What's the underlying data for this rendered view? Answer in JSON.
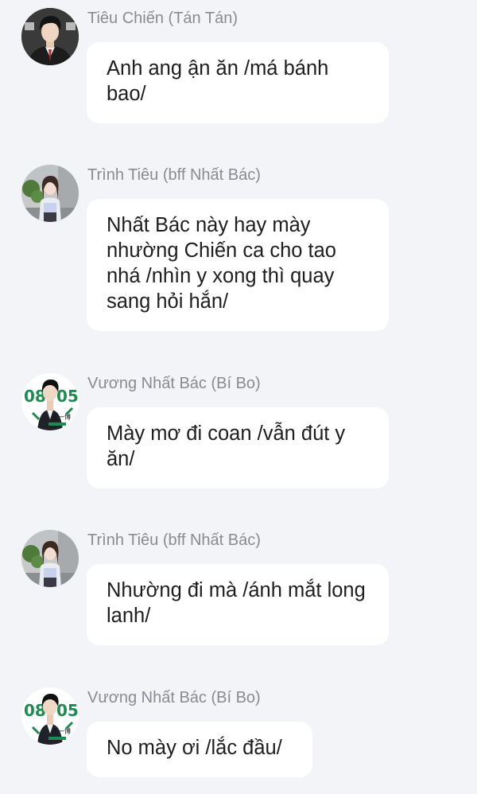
{
  "messages": [
    {
      "sender": "Tiêu Chiến (Tán Tán)",
      "text": "Anh ang ận ăn /má bánh bao/",
      "avatar": "boy-in-suit-avatar"
    },
    {
      "sender": "Trình Tiêu (bff Nhất Bác)",
      "text": "Nhất Bác này hay mày nhường Chiến ca cho tao nhá /nhìn y xong thì quay sang hỏi hắn/",
      "avatar": "girl-in-street-avatar"
    },
    {
      "sender": "Vương Nhất Bác (Bí Bo)",
      "text": "Mày mơ đi coan /vẫn đút y ăn/",
      "avatar": "boy-0805-avatar"
    },
    {
      "sender": "Trình Tiêu (bff Nhất Bác)",
      "text": "Nhường đi mà /ánh mắt long lanh/",
      "avatar": "girl-in-street-avatar"
    },
    {
      "sender": "Vương Nhất Bác (Bí Bo)",
      "text": "No mày ơi /lắc đầu/",
      "avatar": "boy-0805-avatar"
    }
  ],
  "colors": {
    "background": "#f3f4f8",
    "bubble": "#ffffff",
    "sender": "#8a8a8f",
    "text": "#1e1e1e"
  }
}
